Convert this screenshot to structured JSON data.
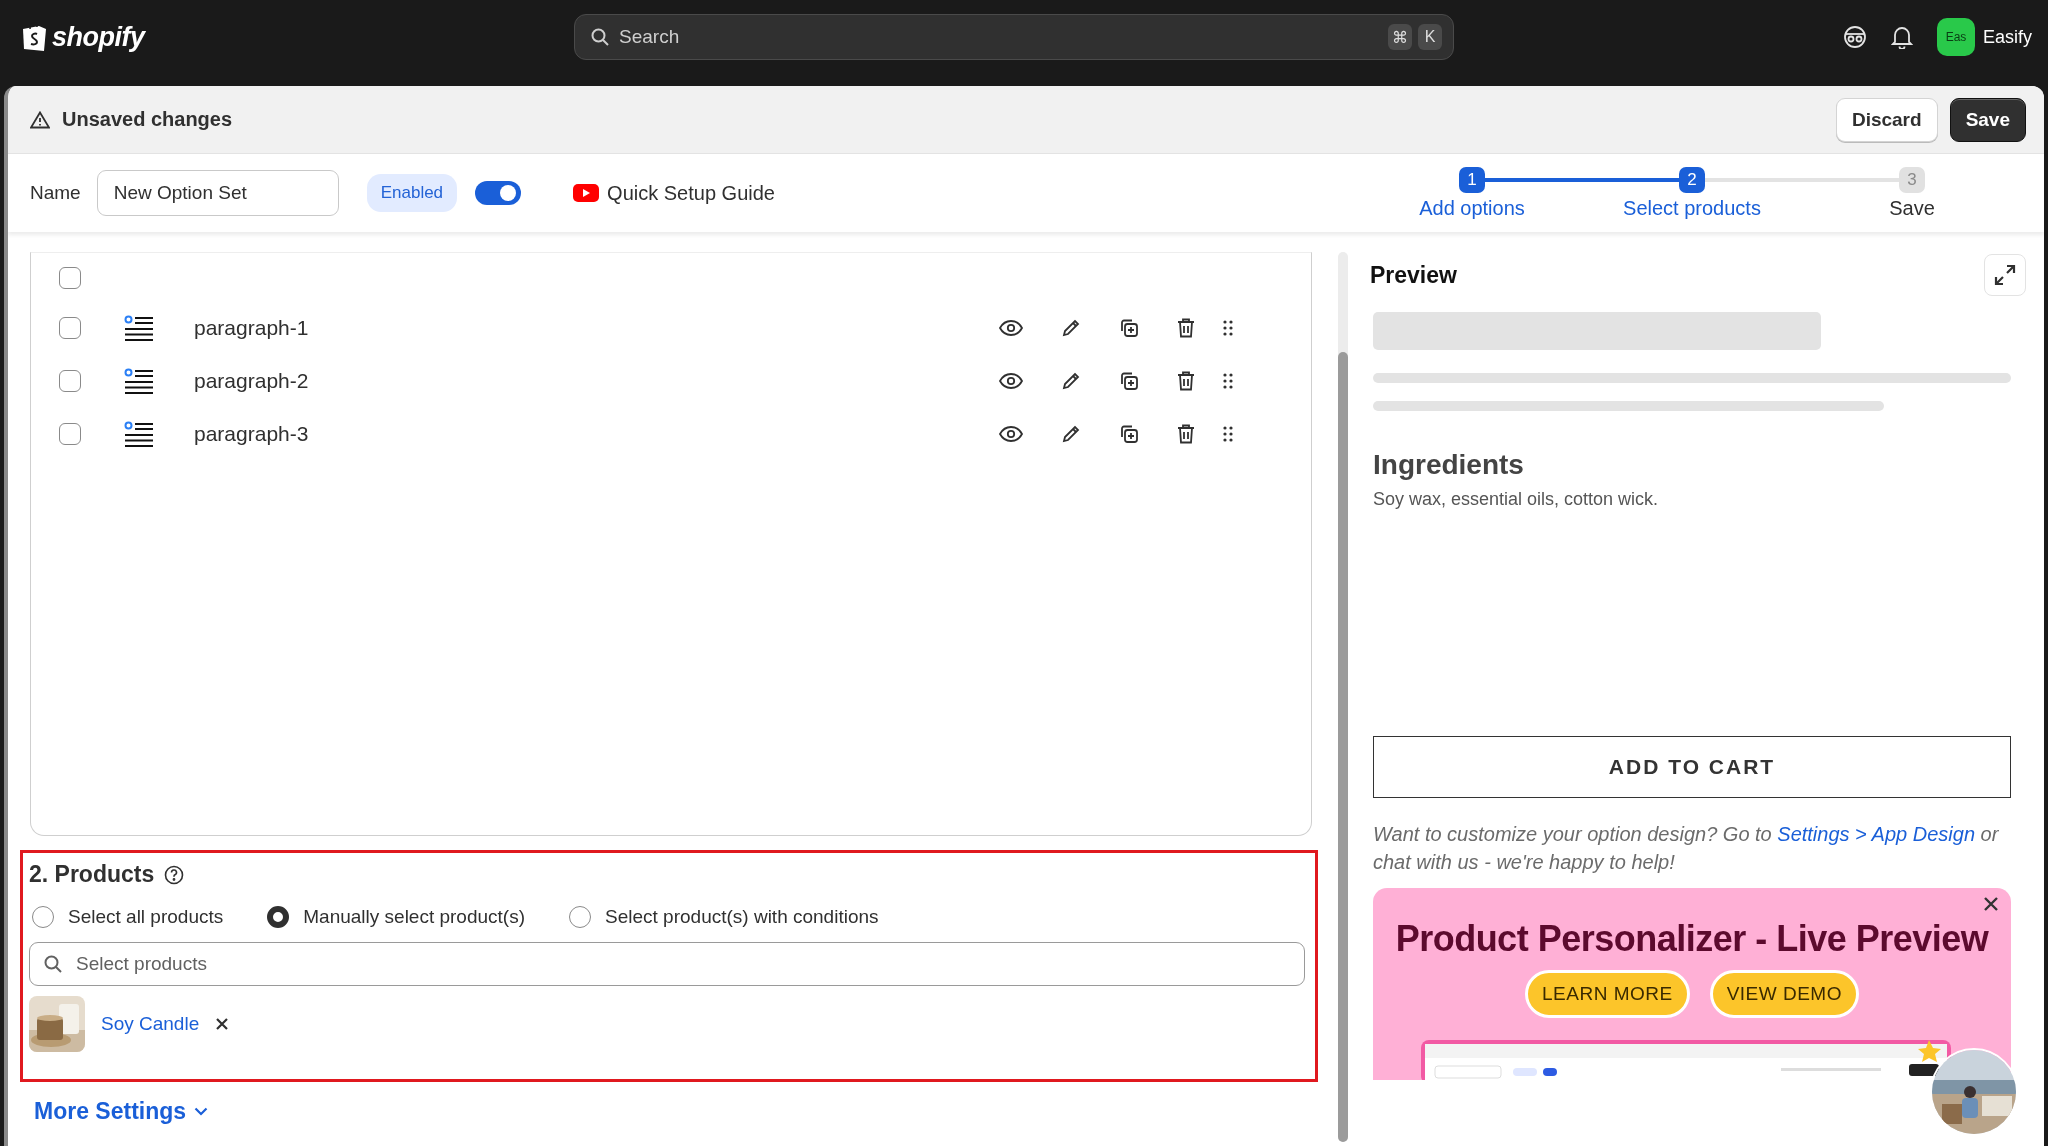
{
  "topbar": {
    "logo": "shopify",
    "search": {
      "placeholder": "Search",
      "keys": [
        "⌘",
        "K"
      ]
    },
    "store": {
      "avatar_text": "Eas",
      "name": "Easify"
    }
  },
  "save_bar": {
    "title": "Unsaved changes",
    "buttons": [
      {
        "label": "Discard",
        "kind": "secondary"
      },
      {
        "label": "Save",
        "kind": "primary"
      }
    ]
  },
  "setup": {
    "name_label": "Name",
    "name_value": "New Option Set",
    "status_badge": "Enabled",
    "enabled": true,
    "guide_link": "Quick Setup Guide"
  },
  "stepper": {
    "steps": [
      {
        "number": "1",
        "label": "Add options",
        "reached": true
      },
      {
        "number": "2",
        "label": "Select products",
        "reached": true
      },
      {
        "number": "3",
        "label": "Save",
        "reached": false
      }
    ]
  },
  "options": {
    "select_all_checked": false,
    "rows": [
      {
        "name": "paragraph-1",
        "checked": false
      },
      {
        "name": "paragraph-2",
        "checked": false
      },
      {
        "name": "paragraph-3",
        "checked": false
      }
    ]
  },
  "products": {
    "title": "2. Products",
    "radios": [
      {
        "label": "Select all products",
        "selected": false
      },
      {
        "label": "Manually select product(s)",
        "selected": true
      },
      {
        "label": "Select product(s) with conditions",
        "selected": false
      }
    ],
    "search": {
      "placeholder": "Select products"
    },
    "selected_products": [
      {
        "name": "Soy Candle"
      }
    ]
  },
  "more_settings": "More Settings",
  "preview": {
    "title": "Preview",
    "heading": "Ingredients",
    "description": "Soy wax, essential oils, cotton wick.",
    "add_to_cart": "ADD TO CART",
    "help_before": "Want to customize your option design? Go to",
    "help_link": "Settings > App Design",
    "help_after": "or chat with us - we're happy to help!"
  },
  "banner": {
    "title": "Product Personalizer - Live Preview",
    "buttons": [
      "LEARN MORE",
      "VIEW DEMO"
    ]
  }
}
